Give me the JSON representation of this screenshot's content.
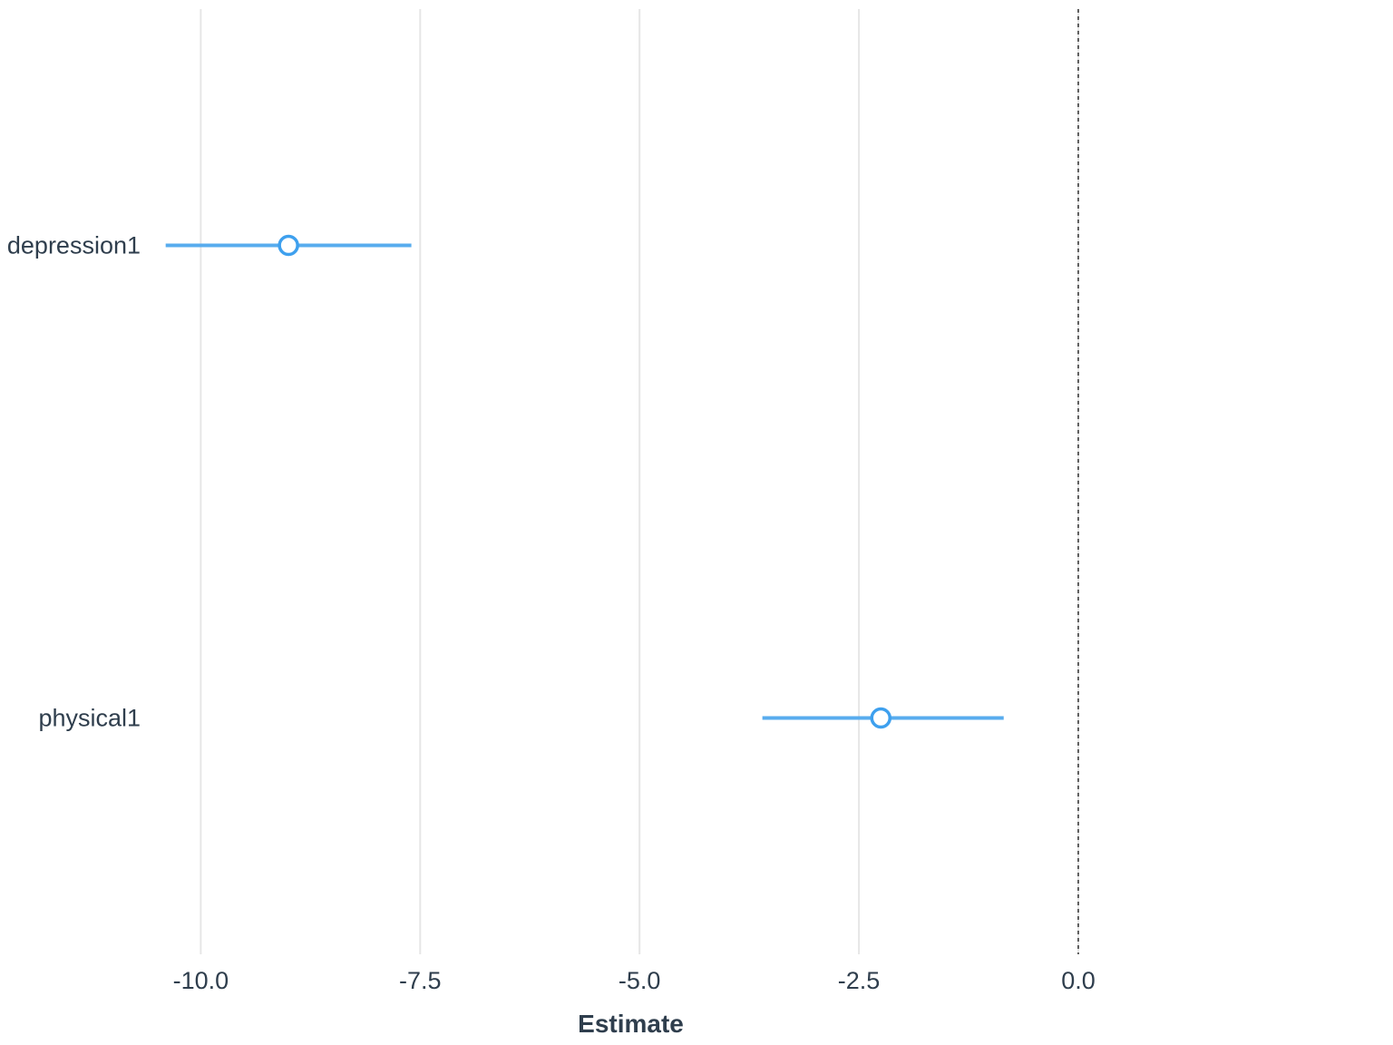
{
  "chart_data": {
    "type": "scatter",
    "xlabel": "Estimate",
    "ylabel": "",
    "xlim": [
      -10.5,
      0.3
    ],
    "xticks": [
      -10.0,
      -7.5,
      -5.0,
      -2.5,
      0.0
    ],
    "categories": [
      "depression1",
      "physical1"
    ],
    "reference_line": 0.0,
    "series": [
      {
        "name": "depression1",
        "estimate": -9.0,
        "ci_low": -10.4,
        "ci_high": -7.6
      },
      {
        "name": "physical1",
        "estimate": -2.25,
        "ci_low": -3.6,
        "ci_high": -0.85
      }
    ],
    "colors": {
      "point": "#3ea0ee",
      "grid": "#e6e6e6",
      "text": "#2f3e4d"
    }
  }
}
